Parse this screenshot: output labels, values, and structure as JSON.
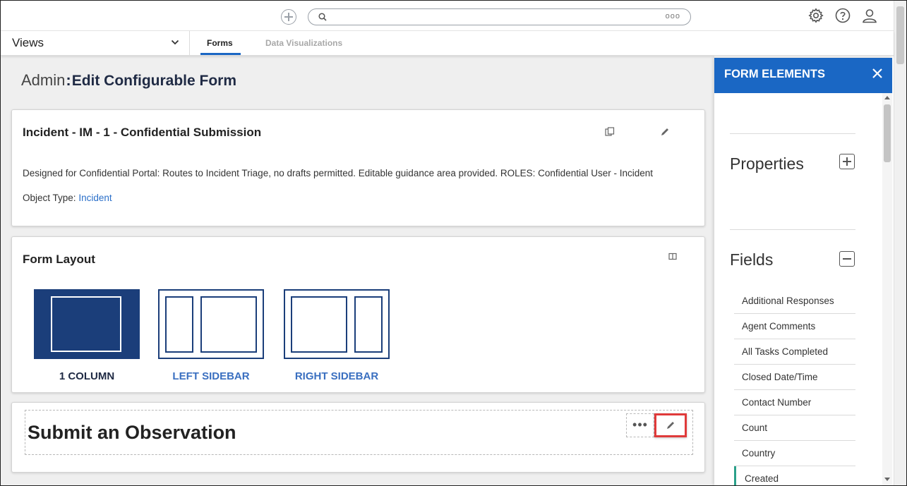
{
  "topbar": {
    "add_icon": "plus-circle-icon",
    "search": {
      "placeholder": "",
      "more_label": "ooo"
    },
    "icons": [
      "gear-icon",
      "help-icon",
      "user-icon"
    ]
  },
  "nav": {
    "views_label": "Views",
    "tabs": [
      {
        "label": "Forms",
        "active": true
      },
      {
        "label": "Data Visualizations",
        "active": false
      }
    ]
  },
  "page": {
    "title_prefix": "Admin",
    "title_separator": ":",
    "title": "Edit Configurable Form"
  },
  "form_card": {
    "title": "Incident - IM - 1 - Confidential Submission",
    "description": "Designed for Confidential Portal: Routes to Incident Triage, no drafts permitted. Editable guidance area provided. ROLES: Confidential User - Incident",
    "object_type_label": "Object Type:",
    "object_type_value": "Incident"
  },
  "layout_card": {
    "title": "Form Layout",
    "options": [
      {
        "label": "1 COLUMN",
        "selected": true
      },
      {
        "label": "LEFT SIDEBAR",
        "selected": false
      },
      {
        "label": "RIGHT SIDEBAR",
        "selected": false
      }
    ]
  },
  "section_card": {
    "title": "Submit an Observation",
    "more_label": "•••"
  },
  "panel": {
    "title": "FORM ELEMENTS",
    "properties_label": "Properties",
    "fields_label": "Fields",
    "fields": [
      "Additional Responses",
      "Agent Comments",
      "All Tasks Completed",
      "Closed Date/Time",
      "Contact Number",
      "Count",
      "Country",
      "Created"
    ]
  },
  "colors": {
    "accent": "#1a67c4",
    "layout_selected": "#1b3e7a",
    "highlight": "#e03a3a",
    "link": "#2a6fc9",
    "active_field_marker": "#2aa08a"
  }
}
